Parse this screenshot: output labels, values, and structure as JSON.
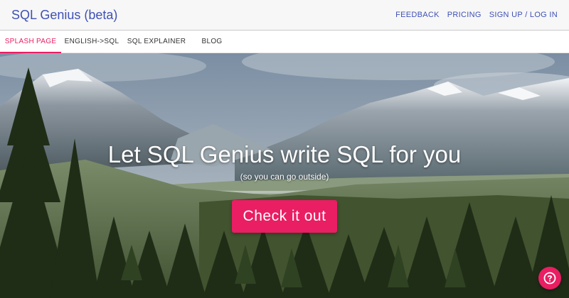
{
  "header": {
    "brand": "SQL Genius (beta)",
    "nav": [
      {
        "label": "FEEDBACK"
      },
      {
        "label": "PRICING"
      },
      {
        "label": "SIGN UP / LOG IN"
      }
    ]
  },
  "tabs": [
    {
      "label": "SPLASH PAGE",
      "active": true
    },
    {
      "label": "ENGLISH->SQL",
      "active": false
    },
    {
      "label": "SQL EXPLAINER",
      "active": false
    },
    {
      "label": "BLOG",
      "active": false
    }
  ],
  "hero": {
    "headline": "Let SQL Genius write SQL for you",
    "subline": "(so you can go outside)",
    "cta_label": "Check it out"
  },
  "help": {
    "icon": "help-icon"
  },
  "colors": {
    "brand": "#3f51b5",
    "accent": "#e91e63"
  }
}
